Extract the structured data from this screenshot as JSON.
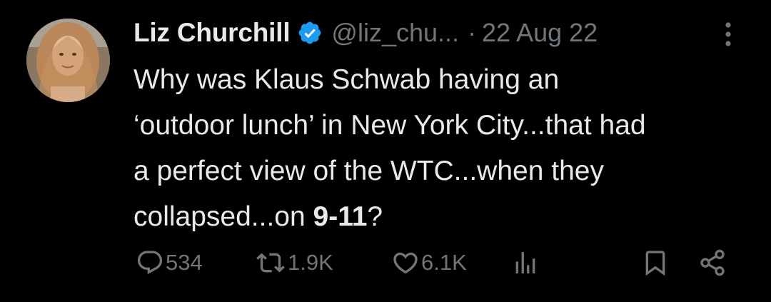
{
  "tweet": {
    "author_name": "Liz Churchill",
    "handle": "@liz_chu...",
    "separator": "·",
    "date": "22 Aug 22",
    "text_line1": "Why was Klaus Schwab having an",
    "text_line2": "‘outdoor lunch’ in New York City...that had",
    "text_line3": "a perfect view of the WTC...when they",
    "text_line4_prefix": "collapsed...on ",
    "text_line4_bold": "9-11",
    "text_line4_suffix": "?"
  },
  "actions": {
    "replies": "534",
    "reposts": "1.9K",
    "likes": "6.1K"
  },
  "icons": {
    "verified": "verified-badge-icon",
    "more": "more-options-icon",
    "reply": "reply-icon",
    "repost": "repost-icon",
    "like": "like-icon",
    "views": "views-icon",
    "bookmark": "bookmark-icon",
    "share": "share-icon"
  },
  "colors": {
    "background": "#000000",
    "text_primary": "#e7e9ea",
    "text_secondary": "#71767b",
    "verified_blue": "#1d9bf0"
  }
}
